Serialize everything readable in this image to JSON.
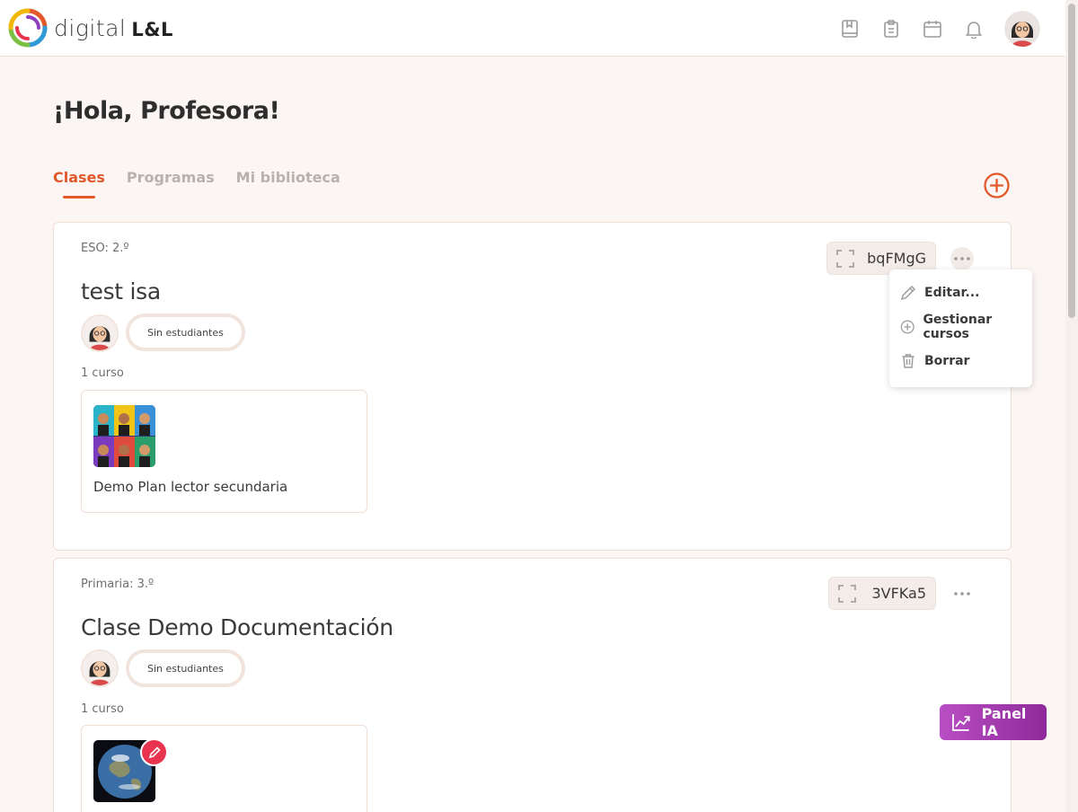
{
  "brand": {
    "name": "digital",
    "suffix": "L&L"
  },
  "header": {
    "icons": [
      "book-icon",
      "clipboard-icon",
      "calendar-icon",
      "bell-icon"
    ],
    "avatar": "user-avatar"
  },
  "greeting": "¡Hola, Profesora!",
  "tabs": [
    {
      "label": "Clases",
      "active": true
    },
    {
      "label": "Programas",
      "active": false
    },
    {
      "label": "Mi biblioteca",
      "active": false
    }
  ],
  "classes": [
    {
      "level": "ESO: 2.º",
      "title": "test isa",
      "students_label": "Sin estudiantes",
      "course_count": "1 curso",
      "code": "bqFMgG",
      "courses": [
        {
          "name": "Demo Plan lector secundaria"
        }
      ]
    },
    {
      "level": "Primaria: 3.º",
      "title": "Clase Demo Documentación",
      "students_label": "Sin estudiantes",
      "course_count": "1 curso",
      "code": "3VFKa5",
      "courses": [
        {
          "name": ""
        }
      ]
    }
  ],
  "menu": {
    "items": [
      {
        "label": "Editar...",
        "icon": "pencil-icon"
      },
      {
        "label": "Gestionar cursos",
        "icon": "plus-circle-icon"
      },
      {
        "label": "Borrar",
        "icon": "trash-icon"
      }
    ]
  },
  "panel_ia": {
    "label": "Panel IA"
  },
  "colors": {
    "accent": "#e2582a",
    "panel_ia": "#a83bb5",
    "edit_badge": "#e8344e"
  }
}
